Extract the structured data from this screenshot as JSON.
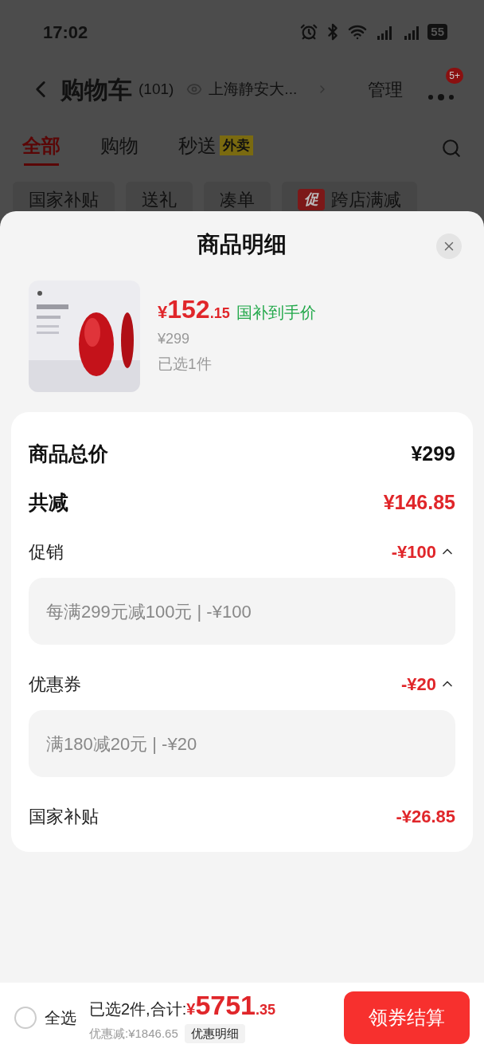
{
  "status_bar": {
    "time": "17:02",
    "battery": "55"
  },
  "header": {
    "title": "购物车",
    "count": "(101)",
    "location": "上海静安大...",
    "manage": "管理",
    "badge": "5+"
  },
  "tabs": [
    {
      "label": "全部",
      "selected": true
    },
    {
      "label": "购物",
      "selected": false
    },
    {
      "label": "秒送",
      "selected": false,
      "tag": "外卖"
    }
  ],
  "filters": [
    {
      "label": "国家补贴"
    },
    {
      "label": "送礼"
    },
    {
      "label": "凑单"
    },
    {
      "label": "跨店满减",
      "promo_tag": "促"
    }
  ],
  "sheet": {
    "title": "商品明细",
    "product": {
      "currency": "¥",
      "price": "152",
      "price_decimal": ".15",
      "price_note": "国补到手价",
      "original_price": "¥299",
      "selected_count": "已选1件"
    },
    "rows": [
      {
        "kind": "total",
        "label": "商品总价",
        "amount": "¥299"
      },
      {
        "kind": "total",
        "label": "共减",
        "amount": "¥146.85",
        "highlight": true
      },
      {
        "kind": "discount",
        "label": "促销",
        "amount": "-¥100",
        "expanded": true,
        "detail": "每满299元减100元 | -¥100"
      },
      {
        "kind": "discount",
        "label": "优惠券",
        "amount": "-¥20",
        "expanded": true,
        "detail": "满180减20元 | -¥20"
      },
      {
        "kind": "discount",
        "label": "国家补贴",
        "amount": "-¥26.85"
      }
    ]
  },
  "bottom_bar": {
    "select_all": {
      "label": "全选",
      "checked": false
    },
    "summary": "已选2件,合计:",
    "currency": "¥",
    "total": "5751",
    "total_decimal": ".35",
    "discount": "优惠减:¥1846.65",
    "detail_button": "优惠明细",
    "checkout": "领券结算"
  }
}
